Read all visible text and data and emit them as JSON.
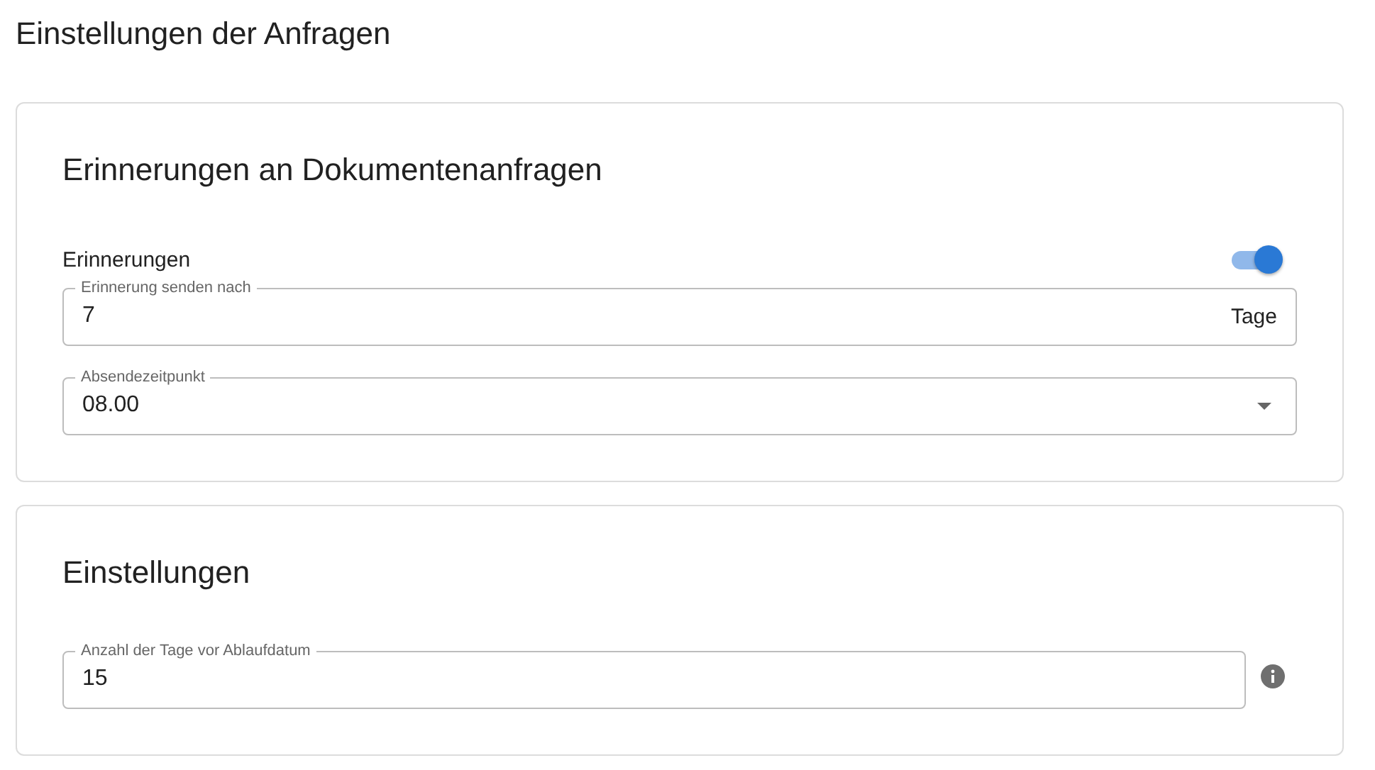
{
  "page_title": "Einstellungen der Anfragen",
  "sections": [
    {
      "heading": "Erinnerungen an Dokumentenanfragen",
      "items": [
        {
          "kind": "toggle",
          "label": "Erinnerungen",
          "on": true
        },
        {
          "kind": "text",
          "label": "Erinnerung senden nach",
          "value": "7",
          "suffix": "Tage",
          "info": false
        },
        {
          "kind": "select",
          "label": "Absendezeitpunkt",
          "value": "08.00"
        }
      ]
    },
    {
      "heading": "Einstellungen",
      "items": [
        {
          "kind": "text",
          "label": "Anzahl der Tage vor Ablaufdatum",
          "value": "15",
          "info": true
        }
      ]
    }
  ]
}
